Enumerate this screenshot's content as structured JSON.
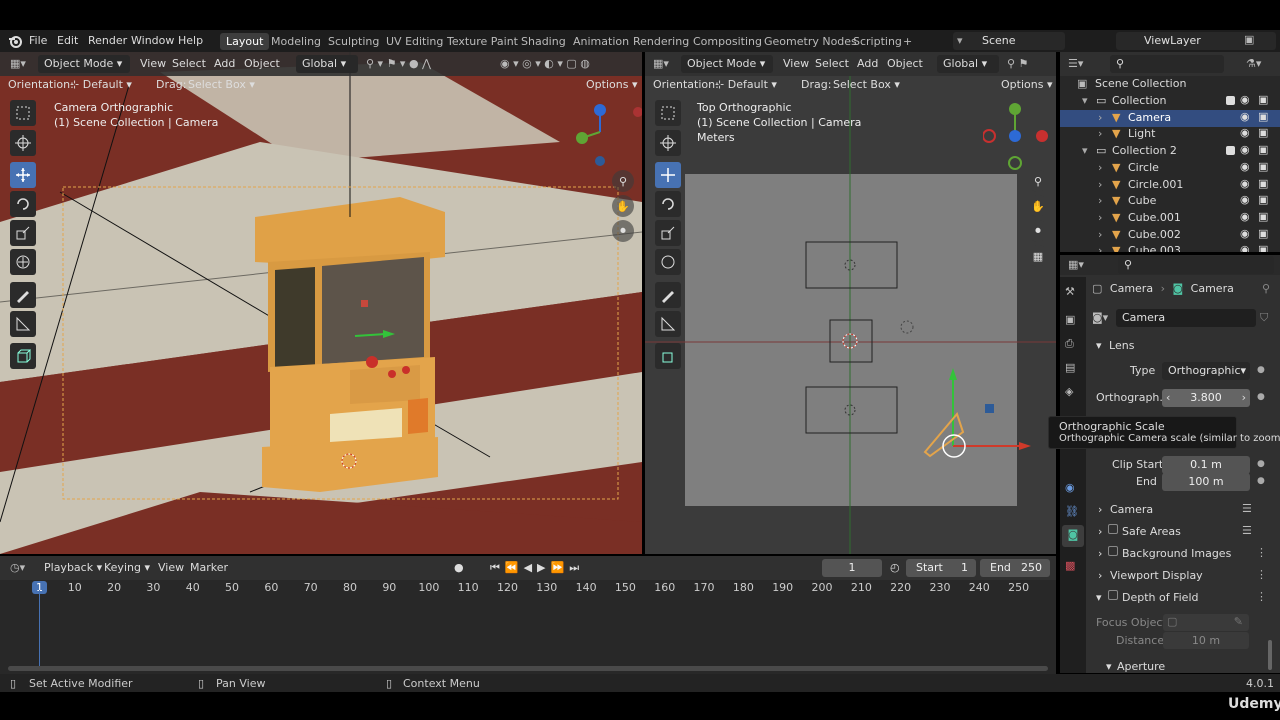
{
  "menu": {
    "file": "File",
    "edit": "Edit",
    "render": "Render",
    "window": "Window",
    "help": "Help"
  },
  "workspaces": [
    "Layout",
    "Modeling",
    "Sculpting",
    "UV Editing",
    "Texture Paint",
    "Shading",
    "Animation",
    "Rendering",
    "Compositing",
    "Geometry Nodes",
    "Scripting"
  ],
  "topbar": {
    "add_tab": "+",
    "scene": "Scene",
    "view_layer": "ViewLayer"
  },
  "left_viewport": {
    "mode": "Object Mode",
    "menus": [
      "View",
      "Select",
      "Add",
      "Object"
    ],
    "transform": "Global",
    "orientation_label": "Orientation:",
    "orientation_value": "Default",
    "drag_label": "Drag:",
    "drag_value": "Select Box",
    "options": "Options",
    "info_line1": "Camera Orthographic",
    "info_line2": "(1) Scene Collection | Camera"
  },
  "right_viewport": {
    "mode": "Object Mode",
    "menus": [
      "View",
      "Select",
      "Add",
      "Object"
    ],
    "transform": "Global",
    "orientation_label": "Orientation:",
    "orientation_value": "Default",
    "drag_label": "Drag:",
    "drag_value": "Select Box",
    "options": "Options",
    "info_line1": "Top Orthographic",
    "info_line2": "(1) Scene Collection | Camera",
    "info_line3": "Meters"
  },
  "outliner": {
    "root": "Scene Collection",
    "items": [
      {
        "label": "Collection",
        "level": 1
      },
      {
        "label": "Camera",
        "level": 2,
        "selected": true
      },
      {
        "label": "Light",
        "level": 2
      },
      {
        "label": "Collection 2",
        "level": 1
      },
      {
        "label": "Circle",
        "level": 2
      },
      {
        "label": "Circle.001",
        "level": 2
      },
      {
        "label": "Cube",
        "level": 2
      },
      {
        "label": "Cube.001",
        "level": 2
      },
      {
        "label": "Cube.002",
        "level": 2
      },
      {
        "label": "Cube.003",
        "level": 2
      }
    ]
  },
  "properties": {
    "breadcrumb_object": "Camera",
    "breadcrumb_data": "Camera",
    "datablock": "Camera",
    "lens_header": "Lens",
    "type_label": "Type",
    "type_value": "Orthographic",
    "ortho_label": "Orthograph...",
    "ortho_value": "3.800",
    "tooltip_title": "Orthographic Scale",
    "tooltip_desc": "Orthographic Camera scale (similar to zoom).",
    "clip_start_label": "Clip Start",
    "clip_start_value": "0.1 m",
    "clip_end_label": "End",
    "clip_end_value": "100 m",
    "panels": [
      "Camera",
      "Safe Areas",
      "Background Images",
      "Viewport Display",
      "Depth of Field"
    ],
    "focus_label": "Focus Object",
    "distance_label": "Distance",
    "distance_value": "10 m",
    "aperture": "Aperture"
  },
  "timeline": {
    "playback": "Playback",
    "keying": "Keying",
    "view": "View",
    "marker": "Marker",
    "current_frame": "1",
    "start_label": "Start",
    "start_value": "1",
    "end_label": "End",
    "end_value": "250",
    "ticks": [
      "1",
      "10",
      "20",
      "30",
      "40",
      "50",
      "60",
      "70",
      "80",
      "90",
      "100",
      "110",
      "120",
      "130",
      "140",
      "150",
      "160",
      "170",
      "180",
      "190",
      "200",
      "210",
      "220",
      "230",
      "240",
      "250"
    ]
  },
  "status": {
    "left": "Set Active Modifier",
    "middle": "Pan View",
    "right": "Context Menu",
    "version": "4.0.1",
    "watermark": "Udemy"
  },
  "colors": {
    "accent": "#4772b3",
    "selection": "#334d80",
    "floor_red": "#7a2f25",
    "floor_light": "#c9c3b4",
    "arcade": "#e3a44b"
  }
}
